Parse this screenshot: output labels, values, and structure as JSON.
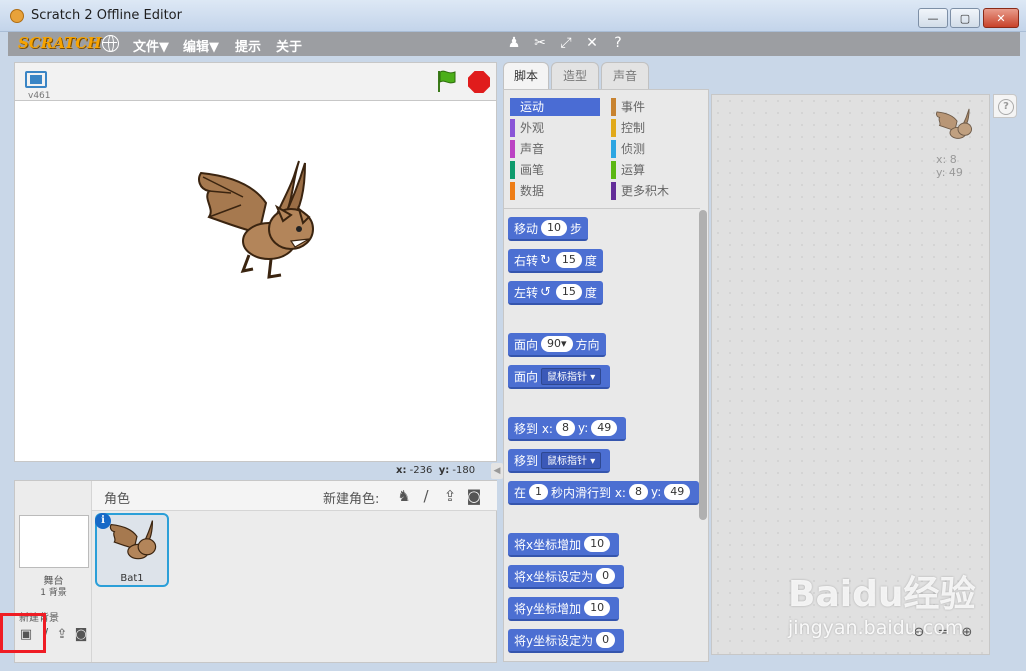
{
  "window": {
    "title": "Scratch 2 Offline Editor",
    "min": "—",
    "max": "▢",
    "close": "✕"
  },
  "menu": {
    "logo": "SCRATCH",
    "file": "文件▼",
    "edit": "编辑▼",
    "tips": "提示",
    "about": "关于",
    "tools": [
      "duplicate-icon",
      "delete-icon",
      "grow-icon",
      "shrink-icon",
      "help-icon"
    ]
  },
  "stage": {
    "version": "v461",
    "mouse_x_label": "x:",
    "mouse_x": "-236",
    "mouse_y_label": "y:",
    "mouse_y": "-180"
  },
  "sprite_pane": {
    "title": "角色",
    "new_sprite_label": "新建角色:",
    "stage_label": "舞台",
    "backdrop_count": "1 背景",
    "new_backdrop_label": "新建背景",
    "sprites": [
      {
        "name": "Bat1"
      }
    ]
  },
  "tabs": [
    "脚本",
    "造型",
    "声音"
  ],
  "categories": [
    {
      "label": "运动",
      "color": "#4a6cd4",
      "active": true
    },
    {
      "label": "外观",
      "color": "#8a55d7"
    },
    {
      "label": "声音",
      "color": "#bb42c3"
    },
    {
      "label": "画笔",
      "color": "#0e9a6c"
    },
    {
      "label": "数据",
      "color": "#ee7d16"
    },
    {
      "label": "事件",
      "color": "#c88330"
    },
    {
      "label": "控制",
      "color": "#e1a91a"
    },
    {
      "label": "侦测",
      "color": "#2ca5e2"
    },
    {
      "label": "运算",
      "color": "#5cb712"
    },
    {
      "label": "更多积木",
      "color": "#632d99"
    }
  ],
  "blocks": {
    "move": {
      "a": "移动",
      "v": "10",
      "b": "步"
    },
    "turn_right": {
      "a": "右转",
      "v": "15",
      "b": "度"
    },
    "turn_left": {
      "a": "左转",
      "v": "15",
      "b": "度"
    },
    "point_dir": {
      "a": "面向",
      "v": "90▾",
      "b": "方向"
    },
    "point_towards": {
      "a": "面向",
      "v": "鼠标指针 ▾"
    },
    "goto_xy": {
      "a": "移到 x:",
      "x": "8",
      "b": "y:",
      "y": "49"
    },
    "goto": {
      "a": "移到",
      "v": "鼠标指针 ▾"
    },
    "glide": {
      "a": "在",
      "v": "1",
      "b": "秒内滑行到 x:",
      "x": "8",
      "c": "y:",
      "y": "49"
    },
    "change_x": {
      "a": "将x坐标增加",
      "v": "10"
    },
    "set_x": {
      "a": "将x坐标设定为",
      "v": "0"
    },
    "change_y": {
      "a": "将y坐标增加",
      "v": "10"
    },
    "set_y": {
      "a": "将y坐标设定为",
      "v": "0"
    }
  },
  "scripts_area": {
    "sprite_x": "x: 8",
    "sprite_y": "y: 49",
    "help": "?"
  },
  "watermark": {
    "main": "Baidu经验",
    "sub": "jingyan.baidu.com"
  },
  "colors": {
    "motion": "#4c6fd2",
    "highlight": "#ef1c24",
    "selected_sprite": "#2b9fd8"
  }
}
